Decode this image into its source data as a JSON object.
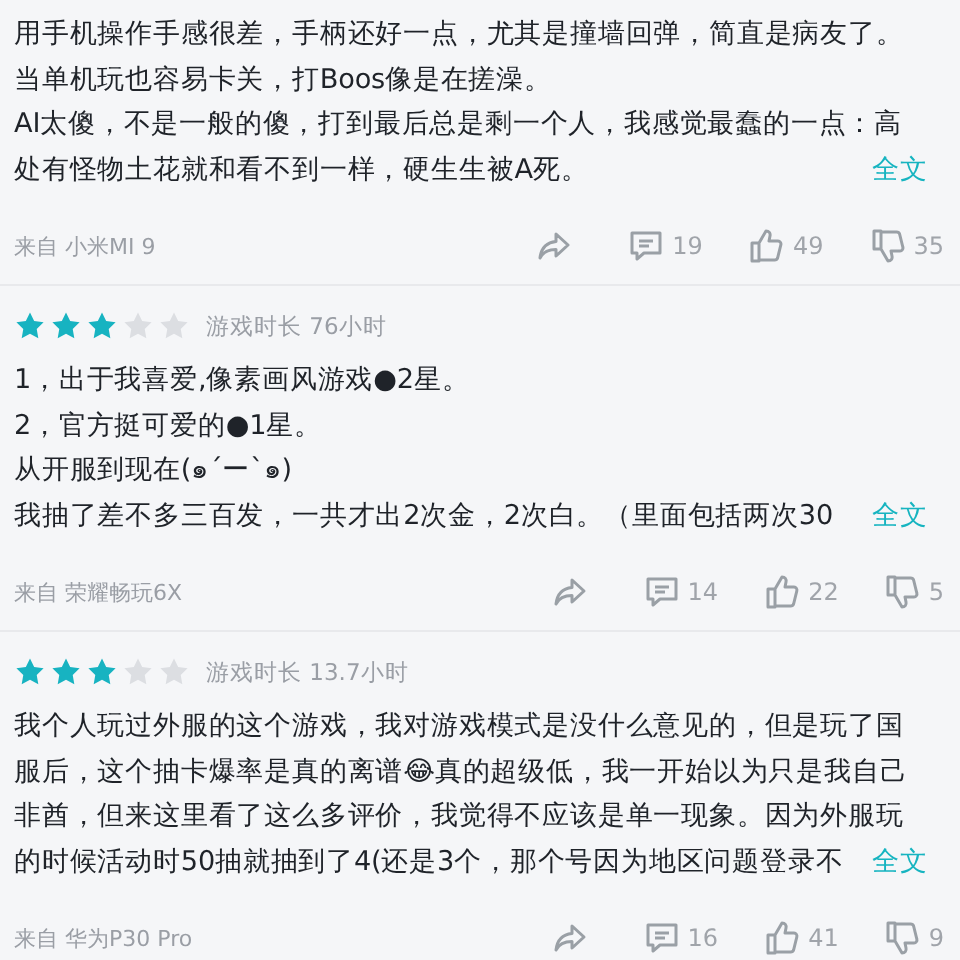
{
  "reviews": [
    {
      "lines": [
        "用手机操作手感很差，手柄还好一点，尤其是撞墙回弹，简直是病友了。",
        "当单机玩也容易卡关，打Boos像是在搓澡。",
        "AI太傻，不是一般的傻，打到最后总是剩一个人，我感觉最蠢的一点：高",
        "处有怪物土花就和看不到一样，硬生生被A死。"
      ],
      "more": "全文",
      "source": "来自 小米MI 9",
      "comments": "19",
      "likes": "49",
      "dislikes": "35"
    },
    {
      "stars": 3,
      "playtime": "游戏时长 76小时",
      "lines": [
        "1，出于我喜爱,像素画风游戏●2星。",
        "2，官方挺可爱的●1星。",
        "从开服到现在(๑´ー`๑)",
        "我抽了差不多三百发，一共才出2次金，2次白。（里面包括两次30"
      ],
      "more": "全文",
      "source": "来自 荣耀畅玩6X",
      "comments": "14",
      "likes": "22",
      "dislikes": "5"
    },
    {
      "stars": 3,
      "playtime": "游戏时长 13.7小时",
      "lines": [
        "我个人玩过外服的这个游戏，我对游戏模式是没什么意见的，但是玩了国",
        "服后，这个抽卡爆率是真的离谱😂真的超级低，我一开始以为只是我自己",
        "非酋，但来这里看了这么多评价，我觉得不应该是单一现象。因为外服玩",
        "的时候活动时50抽就抽到了4(还是3个，那个号因为地区问题登录不"
      ],
      "more": "全文",
      "source": "来自 华为P30 Pro",
      "comments": "16",
      "likes": "41",
      "dislikes": "9"
    }
  ]
}
